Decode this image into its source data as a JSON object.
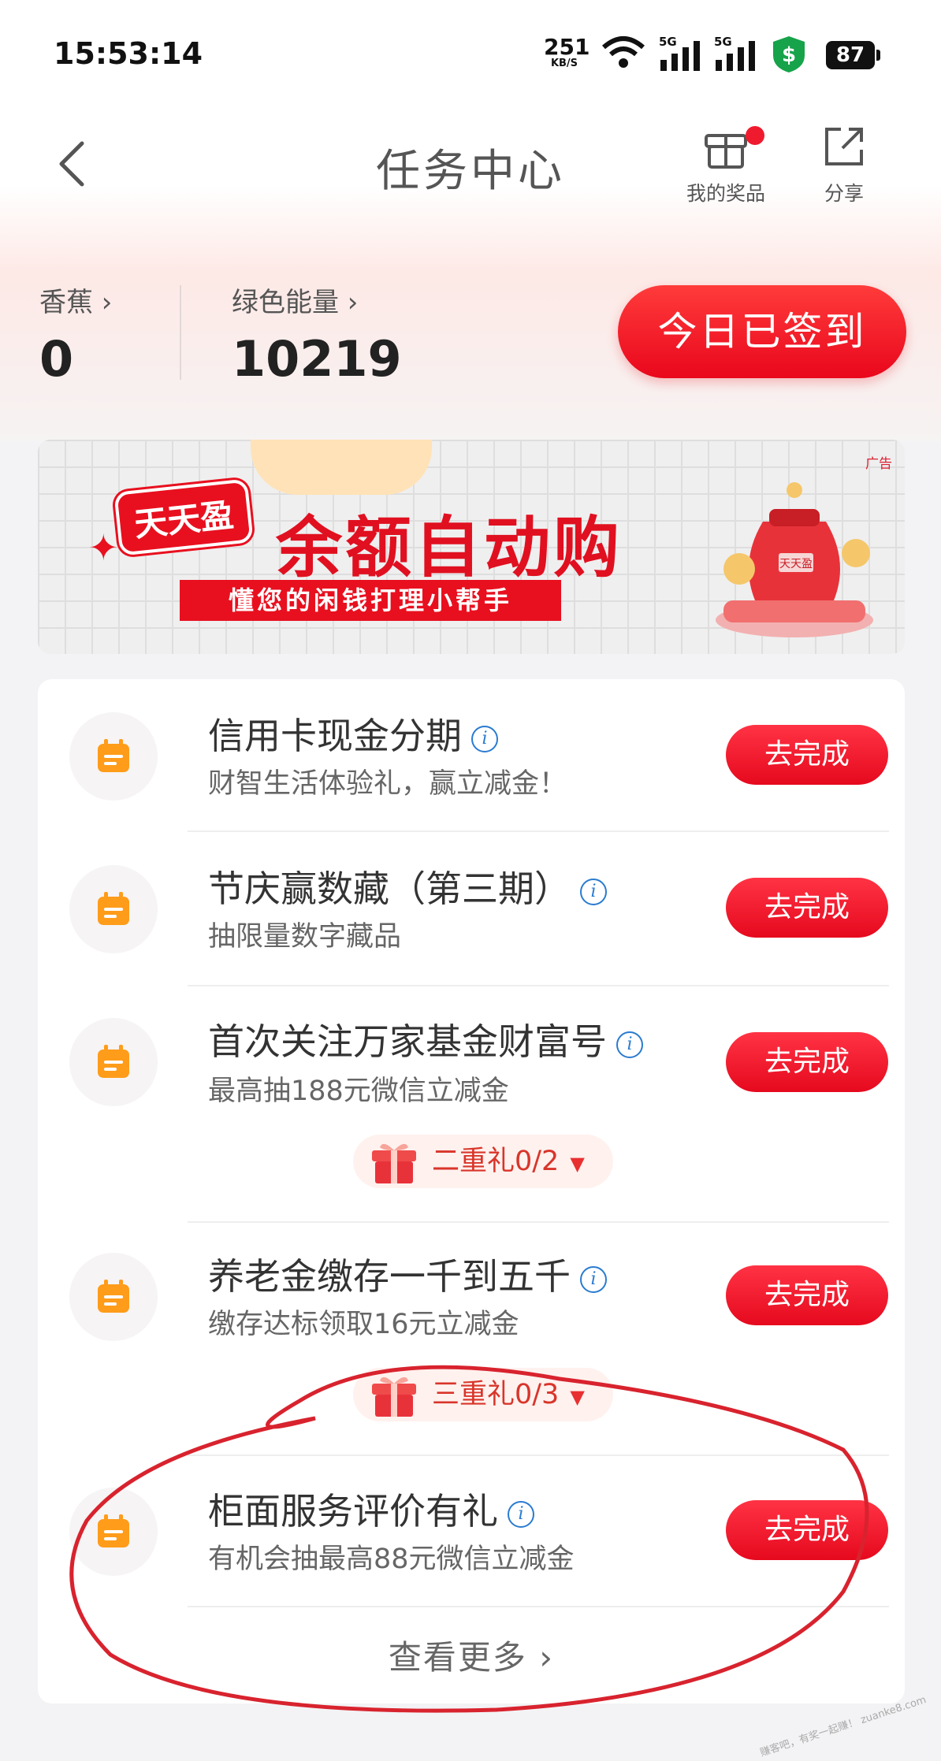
{
  "status_bar": {
    "time": "15:53:14",
    "net_speed": "251",
    "net_unit": "KB/S",
    "signal_1": "5G",
    "signal_2": "5G",
    "battery": "87"
  },
  "header": {
    "title": "任务中心",
    "prizes_label": "我的奖品",
    "share_label": "分享"
  },
  "balances": {
    "banana_label": "香蕉",
    "banana_value": "0",
    "energy_label": "绿色能量",
    "energy_value": "10219",
    "checkin_label": "今日已签到"
  },
  "banner": {
    "ad_tag": "广告",
    "brand_tag": "天天盈",
    "headline": "余额自动购",
    "subline": "懂您的闲钱打理小帮手",
    "bag_label": "天天盈"
  },
  "tasks": [
    {
      "title": "信用卡现金分期",
      "subtitle": "财智生活体验礼，赢立减金！",
      "button": "去完成"
    },
    {
      "title": "节庆赢数藏（第三期）",
      "subtitle": "抽限量数字藏品",
      "button": "去完成"
    },
    {
      "title": "首次关注万家基金财富号",
      "subtitle": "最高抽188元微信立减金",
      "button": "去完成",
      "tier": "二重礼0/2"
    },
    {
      "title": "养老金缴存一千到五千",
      "subtitle": "缴存达标领取16元立减金",
      "button": "去完成",
      "tier": "三重礼0/3"
    },
    {
      "title": "柜面服务评价有礼",
      "subtitle": "有机会抽最高88元微信立减金",
      "button": "去完成"
    }
  ],
  "info_glyph": "i",
  "more_label": "查看更多",
  "watermark": "赚客吧，有奖一起赚！ zuanke8.com",
  "colors": {
    "accent_red": "#e9071c",
    "icon_orange": "#ff9c1a",
    "info_blue": "#2a7bd0"
  }
}
